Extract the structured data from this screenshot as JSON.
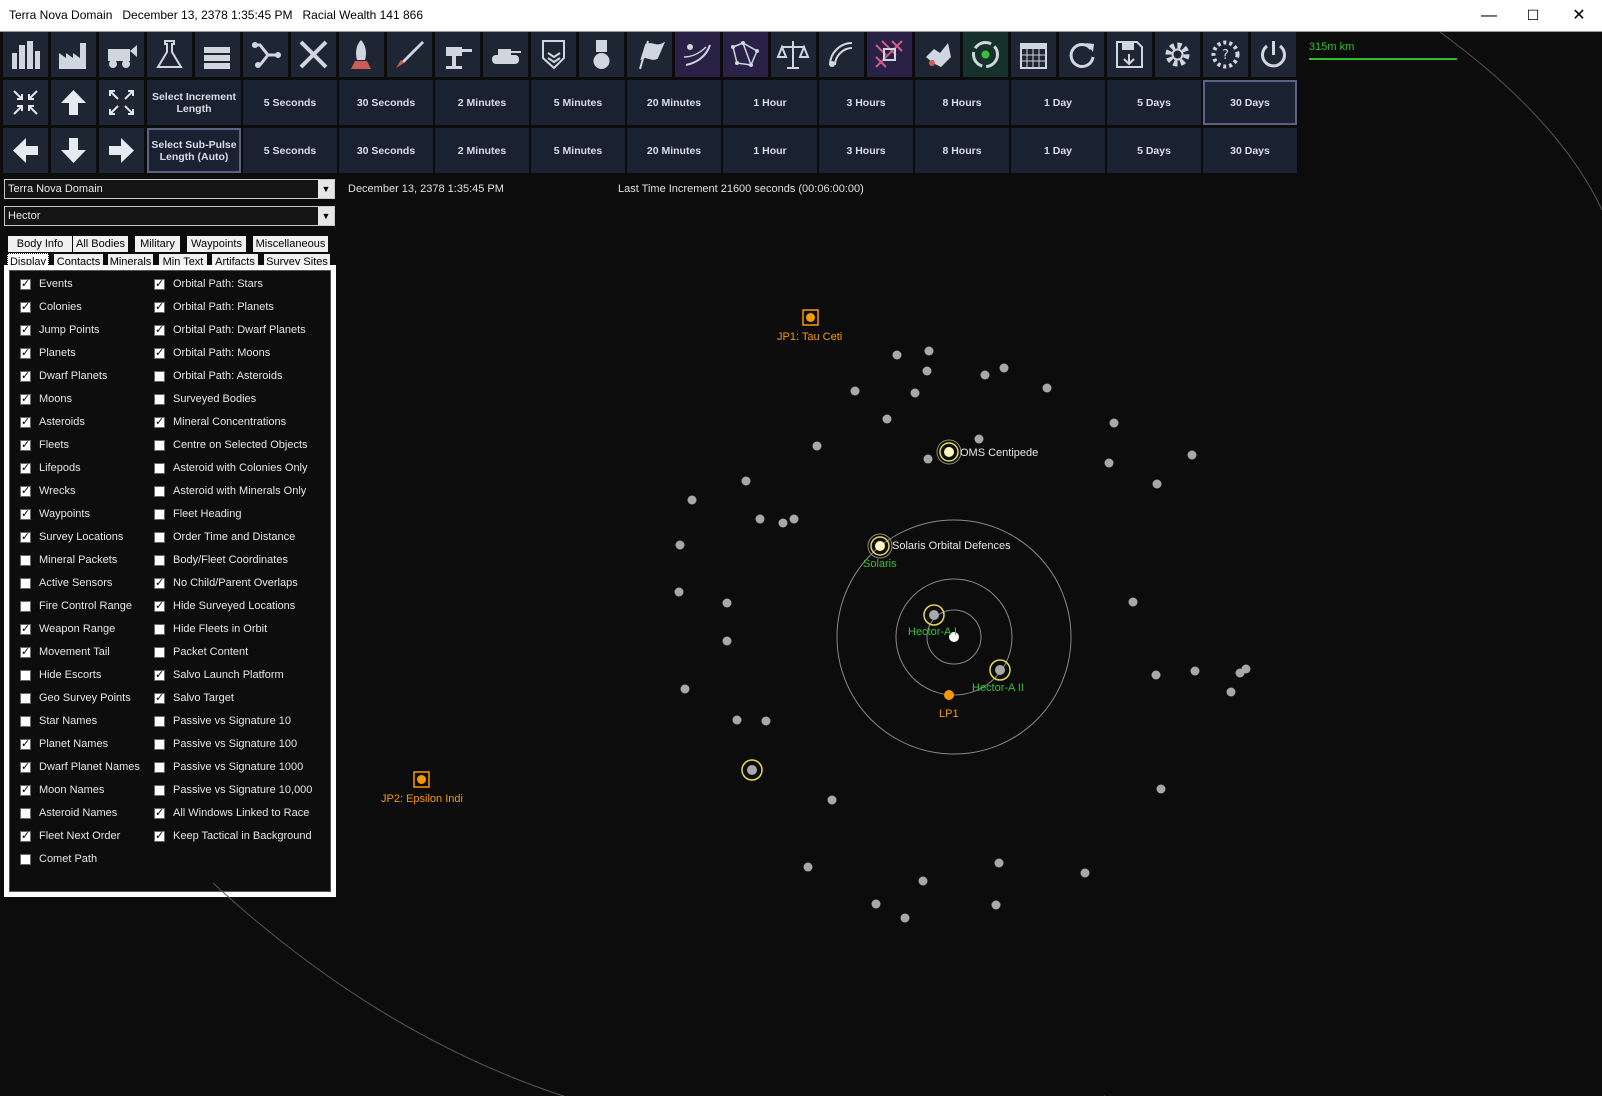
{
  "window": {
    "title": "Terra Nova Domain   December 13, 2378 1:35:45 PM   Racial Wealth 141 866",
    "minimize": "—",
    "maximize": "☐",
    "close": "✕"
  },
  "toolbar": {
    "icons": [
      "population-icon",
      "industry-icon",
      "mining-icon",
      "research-icon",
      "wealth-icon",
      "ship-design-icon",
      "repair-icon",
      "shipyard-icon",
      "missile-icon",
      "ground-unit-icon",
      "ground-forces-icon",
      "commanders-icon",
      "medals-icon",
      "race-flag-icon",
      "system-view-icon",
      "galactic-map-icon",
      "diplomacy-icon",
      "intelligence-icon",
      "technology-icon",
      "xenoarchaeology-icon",
      "recycle-icon",
      "calendar-icon",
      "refresh-icon",
      "save-icon",
      "settings-icon",
      "sm-mode-icon",
      "power-icon"
    ]
  },
  "increments": {
    "select_label": "Select Increment Length",
    "items": [
      "5 Seconds",
      "30 Seconds",
      "2 Minutes",
      "5 Minutes",
      "20 Minutes",
      "1 Hour",
      "3 Hours",
      "8 Hours",
      "1 Day",
      "5 Days",
      "30 Days"
    ],
    "selected": "30 Days"
  },
  "subpulse": {
    "select_label": "Select Sub-Pulse Length (Auto)",
    "items": [
      "5 Seconds",
      "30 Seconds",
      "2 Minutes",
      "5 Minutes",
      "20 Minutes",
      "1 Hour",
      "3 Hours",
      "8 Hours",
      "1 Day",
      "5 Days",
      "30 Days"
    ]
  },
  "race_select": {
    "value": "Terra Nova Domain"
  },
  "system_select": {
    "value": "Hector"
  },
  "tabs_row1": [
    "Body Info",
    "All Bodies",
    "Military",
    "Waypoints",
    "Miscellaneous"
  ],
  "tabs_row2": [
    "Display",
    "Contacts",
    "Minerals",
    "Min Text",
    "Artifacts",
    "Survey Sites"
  ],
  "active_tab": "Display",
  "display_options": {
    "left": [
      {
        "label": "Events",
        "checked": true
      },
      {
        "label": "Colonies",
        "checked": true
      },
      {
        "label": "Jump Points",
        "checked": true
      },
      {
        "label": "Planets",
        "checked": true
      },
      {
        "label": "Dwarf Planets",
        "checked": true
      },
      {
        "label": "Moons",
        "checked": true
      },
      {
        "label": "Asteroids",
        "checked": true
      },
      {
        "label": "Fleets",
        "checked": true
      },
      {
        "label": "Lifepods",
        "checked": true
      },
      {
        "label": "Wrecks",
        "checked": true
      },
      {
        "label": "Waypoints",
        "checked": true
      },
      {
        "label": "Survey Locations",
        "checked": true
      },
      {
        "label": "Mineral Packets",
        "checked": false
      },
      {
        "label": "Active Sensors",
        "checked": false
      },
      {
        "label": "Fire Control Range",
        "checked": false
      },
      {
        "label": "Weapon Range",
        "checked": true
      },
      {
        "label": "Movement Tail",
        "checked": true
      },
      {
        "label": "Hide Escorts",
        "checked": false
      },
      {
        "label": "Geo Survey Points",
        "checked": false
      },
      {
        "label": "Star Names",
        "checked": false
      },
      {
        "label": "Planet Names",
        "checked": true
      },
      {
        "label": "Dwarf Planet Names",
        "checked": true
      },
      {
        "label": "Moon Names",
        "checked": true
      },
      {
        "label": "Asteroid Names",
        "checked": false
      },
      {
        "label": "Fleet Next Order",
        "checked": true
      },
      {
        "label": "Comet Path",
        "checked": false
      }
    ],
    "right": [
      {
        "label": "Orbital Path: Stars",
        "checked": true
      },
      {
        "label": "Orbital Path: Planets",
        "checked": true
      },
      {
        "label": "Orbital Path: Dwarf Planets",
        "checked": true
      },
      {
        "label": "Orbital Path: Moons",
        "checked": true
      },
      {
        "label": "Orbital Path: Asteroids",
        "checked": false
      },
      {
        "label": "Surveyed Bodies",
        "checked": false
      },
      {
        "label": "Mineral Concentrations",
        "checked": true
      },
      {
        "label": "Centre on Selected Objects",
        "checked": false
      },
      {
        "label": "Asteroid with Colonies Only",
        "checked": false
      },
      {
        "label": "Asteroid with Minerals Only",
        "checked": false
      },
      {
        "label": "Fleet Heading",
        "checked": false
      },
      {
        "label": "Order Time and Distance",
        "checked": false
      },
      {
        "label": "Body/Fleet Coordinates",
        "checked": false
      },
      {
        "label": "No Child/Parent Overlaps",
        "checked": true
      },
      {
        "label": "Hide Surveyed Locations",
        "checked": true
      },
      {
        "label": "Hide Fleets in Orbit",
        "checked": false
      },
      {
        "label": "Packet Content",
        "checked": false
      },
      {
        "label": "Salvo Launch Platform",
        "checked": true
      },
      {
        "label": "Salvo Target",
        "checked": true
      },
      {
        "label": "Passive vs Signature 10",
        "checked": false
      },
      {
        "label": "Passive vs Signature 100",
        "checked": false
      },
      {
        "label": "Passive vs Signature 1000",
        "checked": false
      },
      {
        "label": "Passive vs Signature 10,000",
        "checked": false
      },
      {
        "label": "All Windows Linked to Race",
        "checked": true
      },
      {
        "label": "Keep Tactical in Background",
        "checked": true
      }
    ]
  },
  "status": {
    "date": "December 13, 2378 1:35:45 PM",
    "increment": "Last Time Increment 21600 seconds (00:06:00:00)"
  },
  "scale": {
    "label": "315m km"
  },
  "map_labels": {
    "jp1": "JP1: Tau Ceti",
    "jp2": "JP2: Epsilon Indi",
    "fleet1": "OMS Centipede",
    "fleet2": "Solaris Orbital Defences",
    "colony": "Solaris",
    "planet1": "Hector-A I",
    "planet2": "Hector-A II",
    "lp": "LP1"
  },
  "colors": {
    "jump_point": "#f59a00",
    "fleet_yellow": "#e8d84a",
    "colony_green": "#3bbf3b",
    "map_text": "#e6e6e6",
    "body_gray": "#a8a8a8"
  }
}
